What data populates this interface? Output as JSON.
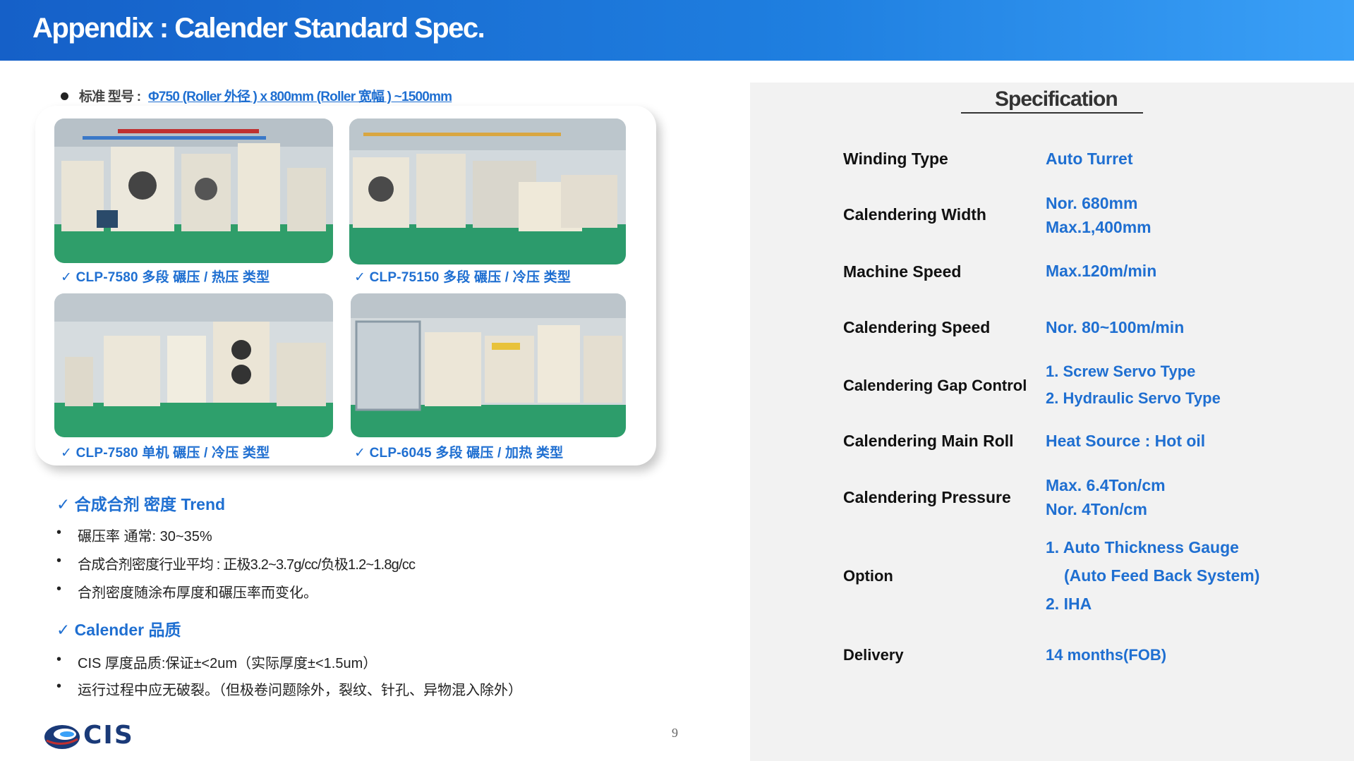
{
  "header": {
    "title": "Appendix : Calender Standard Spec."
  },
  "model": {
    "label": "标准 型号 :",
    "value": "Φ750 (Roller 外径 ) x 800mm (Roller 宽幅 ) ~1500mm"
  },
  "photos": [
    {
      "caption": "✓  CLP-7580   多段  碾压 / 热压 类型"
    },
    {
      "caption": "✓  CLP-75150   多段  碾压 / 冷压 类型"
    },
    {
      "caption": "✓  CLP-7580   单机  碾压 / 冷压 类型"
    },
    {
      "caption": "✓  CLP-6045 多段  碾压 / 加热 类型"
    }
  ],
  "density": {
    "title": "✓ 合成合剂  密度 Trend",
    "items": [
      "碾压率  通常: 30~35%",
      "合成合剂密度行业平均 : 正极3.2~3.7g/cc/负极1.2~1.8g/cc",
      "合剂密度随涂布厚度和碾压率而变化。"
    ]
  },
  "quality": {
    "title": "✓ Calender  品质",
    "items": [
      "CIS  厚度品质:保证±<2um（实际厚度±<1.5um）",
      "运行过程中应无破裂。（但极卷问题除外，裂纹、针孔、异物混入除外）"
    ]
  },
  "bullet": "•",
  "page_number": "9",
  "logo": {
    "text": "CIS"
  },
  "spec": {
    "heading": "Specification",
    "rows": [
      {
        "label": "Winding Type",
        "values": [
          "Auto Turret"
        ]
      },
      {
        "label": "Calendering Width",
        "values": [
          "Nor. 680mm",
          "Max.1,400mm"
        ]
      },
      {
        "label": "Machine Speed",
        "values": [
          "Max.120m/min"
        ]
      },
      {
        "label": "Calendering Speed",
        "values": [
          "Nor. 80~100m/min"
        ]
      },
      {
        "label": "Calendering Gap Control",
        "values": [
          "1. Screw Servo Type",
          "2. Hydraulic Servo Type"
        ]
      },
      {
        "label": "Calendering Main Roll",
        "values": [
          "Heat Source : Hot oil"
        ]
      },
      {
        "label": "Calendering Pressure",
        "values": [
          "Max. 6.4Ton/cm",
          "Nor. 4Ton/cm"
        ]
      },
      {
        "label": "Option",
        "values": [
          "1. Auto Thickness Gauge",
          "(Auto Feed Back System)",
          "2. IHA"
        ]
      },
      {
        "label": "Delivery",
        "values": [
          "14 months(FOB)"
        ]
      }
    ]
  },
  "colors": {
    "accent": "#1f6fd1",
    "header_start": "#1560c8",
    "header_end": "#3aa0f7",
    "panel": "#f2f2f2"
  }
}
